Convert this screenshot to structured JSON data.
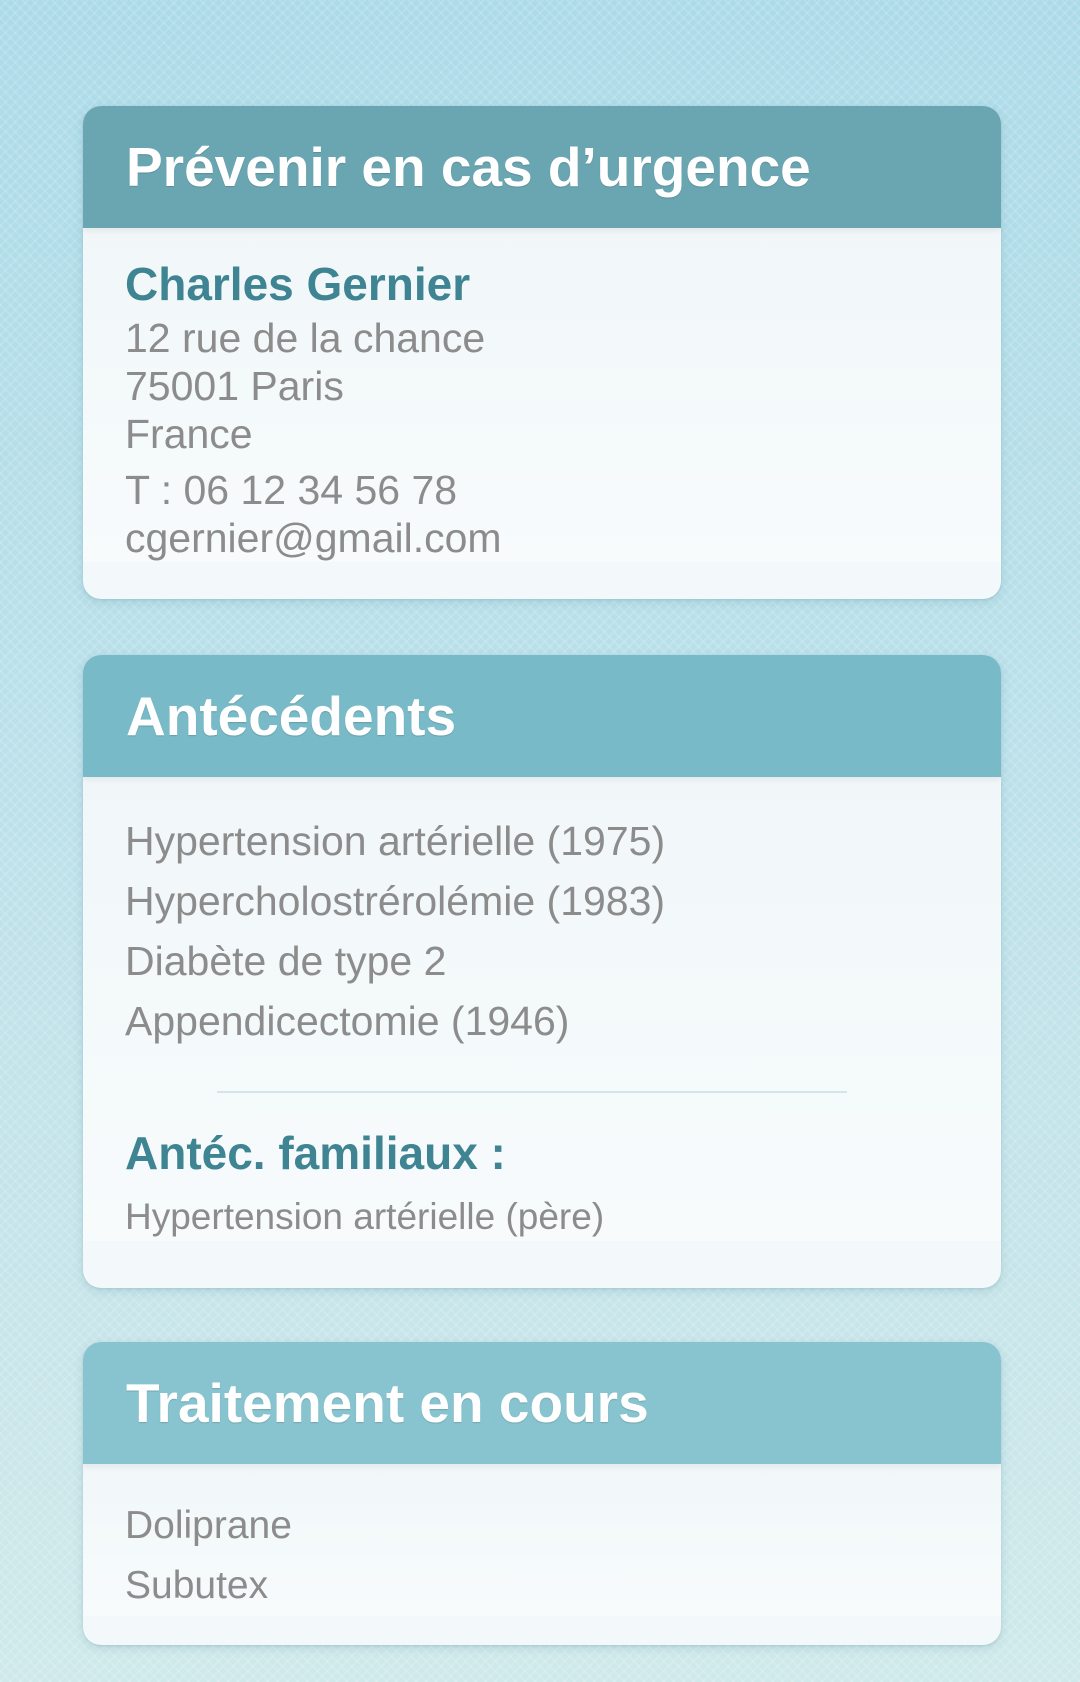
{
  "emergency": {
    "title": "Prévenir en cas d’urgence",
    "name": "Charles Gernier",
    "address_line1": "12 rue de la chance",
    "address_line2": "75001 Paris",
    "address_line3": "France",
    "phone": "T : 06 12 34 56 78",
    "email": "cgernier@gmail.com"
  },
  "history": {
    "title": "Antécédents",
    "items": [
      "Hypertension artérielle (1975)",
      "Hypercholostrérolémie (1983)",
      "Diabète de type 2",
      "Appendicectomie (1946)"
    ],
    "family_title": "Antéc. familiaux :",
    "family_value": "Hypertension artérielle (père)"
  },
  "treatment": {
    "title": "Traitement en cours",
    "items": [
      "Doliprane",
      "Subutex"
    ]
  },
  "colors": {
    "header_emergency": "#6aa6b2",
    "header_history": "#78bac7",
    "header_treatment": "#87c4cf",
    "accent_text": "#3f8492",
    "body_text": "#8c8c8c"
  }
}
